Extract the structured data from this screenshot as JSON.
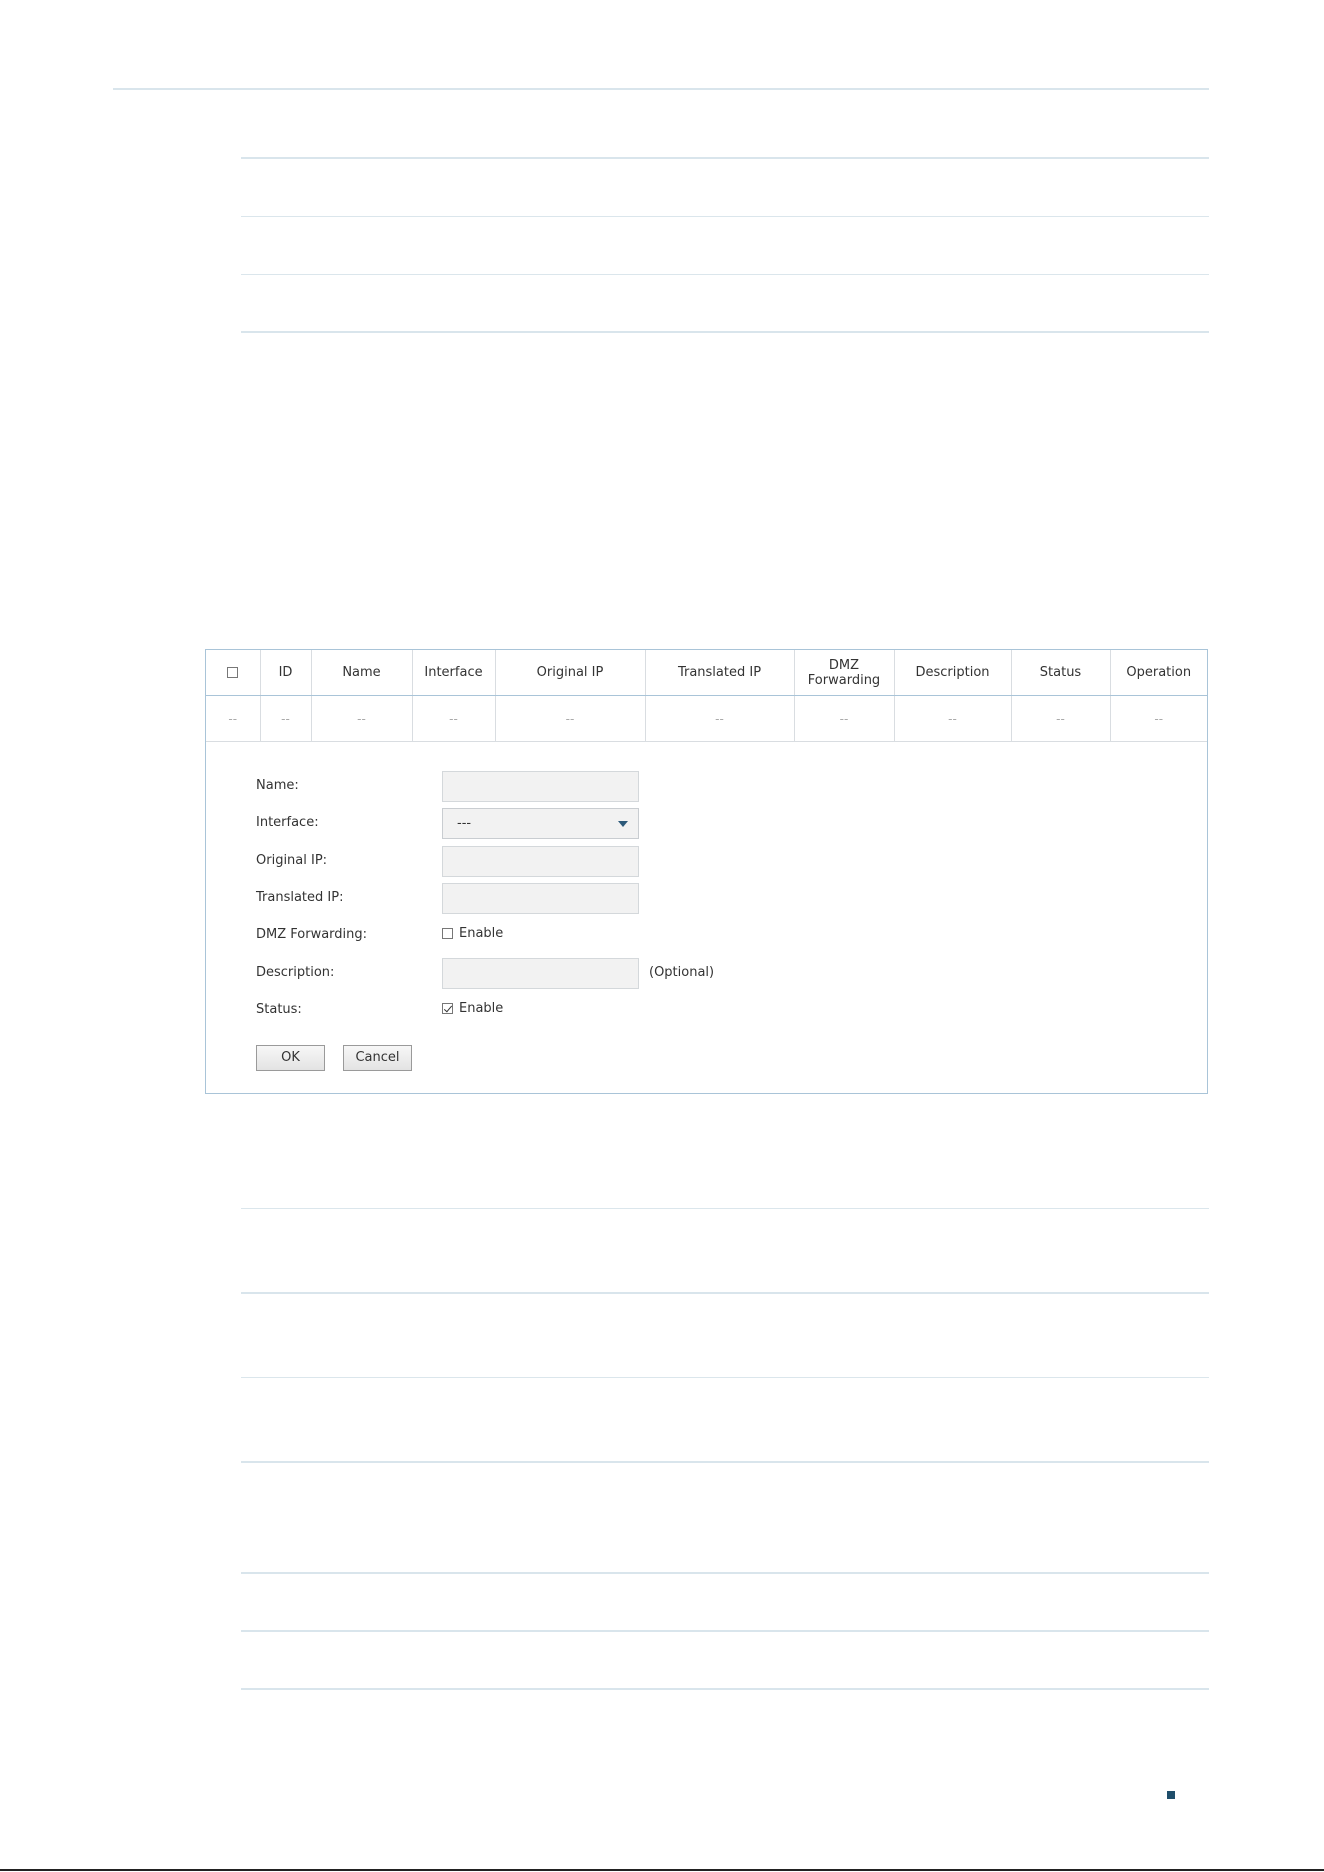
{
  "table": {
    "headers": {
      "id": "ID",
      "name": "Name",
      "interface": "Interface",
      "original_ip": "Original IP",
      "translated_ip": "Translated IP",
      "dmz_line1": "DMZ",
      "dmz_line2": "Forwarding",
      "description": "Description",
      "status": "Status",
      "operation": "Operation"
    },
    "empty_row": [
      "--",
      "--",
      "--",
      "--",
      "--",
      "--",
      "--",
      "--",
      "--",
      "--"
    ]
  },
  "form": {
    "name_label": "Name:",
    "interface_label": "Interface:",
    "interface_value": "---",
    "original_ip_label": "Original IP:",
    "translated_ip_label": "Translated IP:",
    "dmz_label": "DMZ Forwarding:",
    "dmz_enable": "Enable",
    "dmz_checked": false,
    "description_label": "Description:",
    "description_hint": "(Optional)",
    "status_label": "Status:",
    "status_enable": "Enable",
    "status_checked": true,
    "ok": "OK",
    "cancel": "Cancel"
  },
  "colors": {
    "panel_border": "#a9c4d8",
    "rule": "#d9e5ec",
    "select_arrow": "#2d5a7a",
    "footer_square": "#1f4e6b"
  }
}
